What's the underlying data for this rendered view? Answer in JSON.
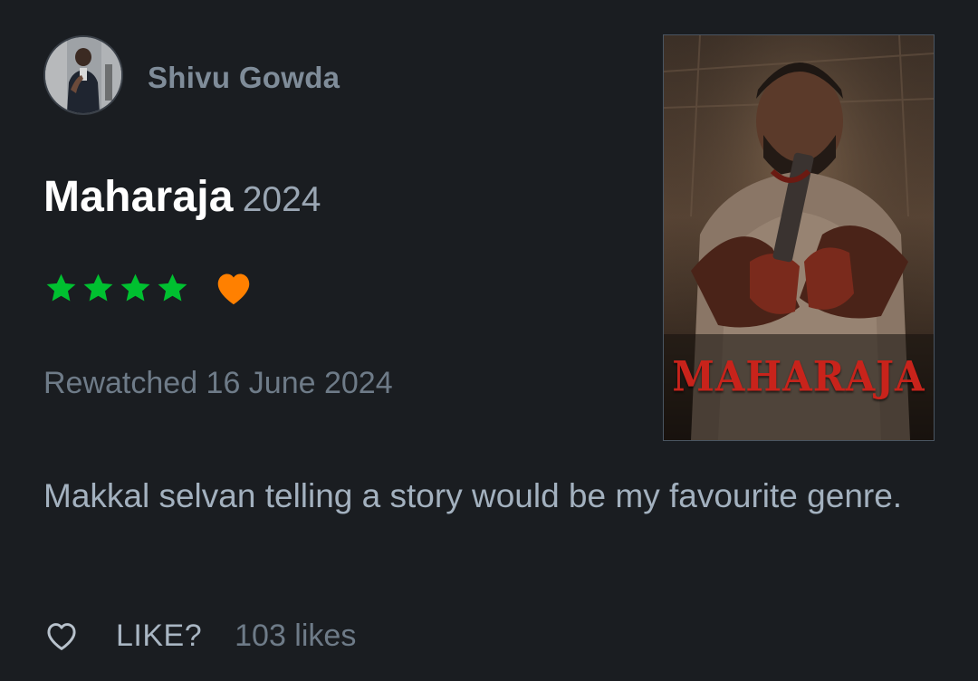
{
  "user": {
    "name": "Shivu Gowda",
    "avatar_icon": "profile-photo"
  },
  "film": {
    "title": "Maharaja",
    "year": "2024",
    "poster_title": "MAHARAJA"
  },
  "rating": {
    "stars": 4,
    "max_stars": 5,
    "liked": true,
    "star_color": "#00c030",
    "heart_color": "#ff8000"
  },
  "activity": "Rewatched 16 June 2024",
  "review_text": "Makkal selvan telling a story would be my favourite genre.",
  "actions": {
    "like_label": "LIKE?",
    "likes_count": "103 likes",
    "like_icon": "heart-outline-icon"
  },
  "colors": {
    "background": "#1a1d21",
    "title": "#ffffff",
    "muted": "#6e7b88"
  }
}
